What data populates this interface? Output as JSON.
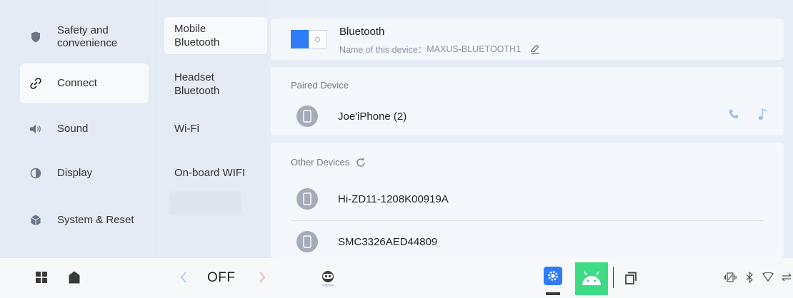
{
  "colors": {
    "accent": "#2f7cf6",
    "android_green": "#3ddc84",
    "call_blue": "#4a90e2"
  },
  "categories": [
    {
      "label": "Safety and\nconvenience",
      "icon": "shield-icon",
      "active": false
    },
    {
      "label": "Connect",
      "icon": "link-icon",
      "active": true
    },
    {
      "label": "Sound",
      "icon": "speaker-icon",
      "active": false
    },
    {
      "label": "Display",
      "icon": "contrast-icon",
      "active": false
    },
    {
      "label": "System & Reset",
      "icon": "cube-icon",
      "active": false
    }
  ],
  "subnav": [
    {
      "label": "Mobile\nBluetooth",
      "active": true
    },
    {
      "label": "Headset\nBluetooth",
      "active": false
    },
    {
      "label": "Wi-Fi",
      "active": false
    },
    {
      "label": "On-board WIFI",
      "active": false
    }
  ],
  "bluetooth": {
    "title": "Bluetooth",
    "device_name_label": "Name of this device：",
    "device_name": "MAXUS-BLUETOOTH1",
    "enabled": true
  },
  "paired": {
    "title": "Paired Device",
    "devices": [
      {
        "name": "Joe'iPhone (2)"
      }
    ]
  },
  "other": {
    "title": "Other Devices",
    "devices": [
      {
        "name": "Hi-ZD11-1208K00919A"
      },
      {
        "name": "SMC3326AED44809"
      }
    ]
  },
  "taskbar": {
    "ac_label": "OFF",
    "icons": [
      "apps-grid-icon",
      "home-icon",
      "chevron-left-icon",
      "chevron-right-icon",
      "assistant-robot-icon",
      "settings-app-icon",
      "android-app-icon",
      "recent-apps-icon",
      "vibrate-icon",
      "bluetooth-status-icon",
      "wifi-status-icon",
      "usb-status-icon"
    ]
  }
}
